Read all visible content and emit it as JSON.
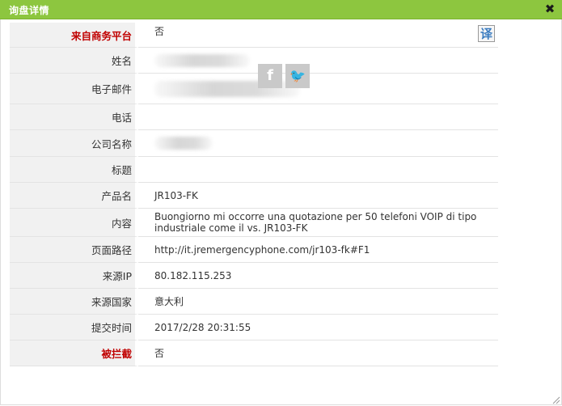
{
  "dialog": {
    "title": "询盘详情",
    "close_glyph": "✖"
  },
  "translate_label": "译",
  "social": {
    "facebook": "f",
    "twitter": "🐦"
  },
  "rows": [
    {
      "label": "来自商务平台",
      "value": "否",
      "highlight": true
    },
    {
      "label": "姓名",
      "value": "",
      "blurred": true
    },
    {
      "label": "电子邮件",
      "value": "",
      "blurred": true
    },
    {
      "label": "电话",
      "value": ""
    },
    {
      "label": "公司名称",
      "value": "",
      "blurred": true
    },
    {
      "label": "标题",
      "value": ""
    },
    {
      "label": "产品名",
      "value": "JR103-FK"
    },
    {
      "label": "内容",
      "value": "Buongiorno mi occorre una quotazione per 50 telefoni VOIP di tipo industriale come il vs. JR103-FK"
    },
    {
      "label": "页面路径",
      "value": "http://it.jremergencyphone.com/jr103-fk#F1"
    },
    {
      "label": "来源IP",
      "value": "80.182.115.253"
    },
    {
      "label": "来源国家",
      "value": "意大利"
    },
    {
      "label": "提交时间",
      "value": "2017/2/28 20:31:55"
    },
    {
      "label": "被拦截",
      "value": "否",
      "highlight": true
    }
  ]
}
